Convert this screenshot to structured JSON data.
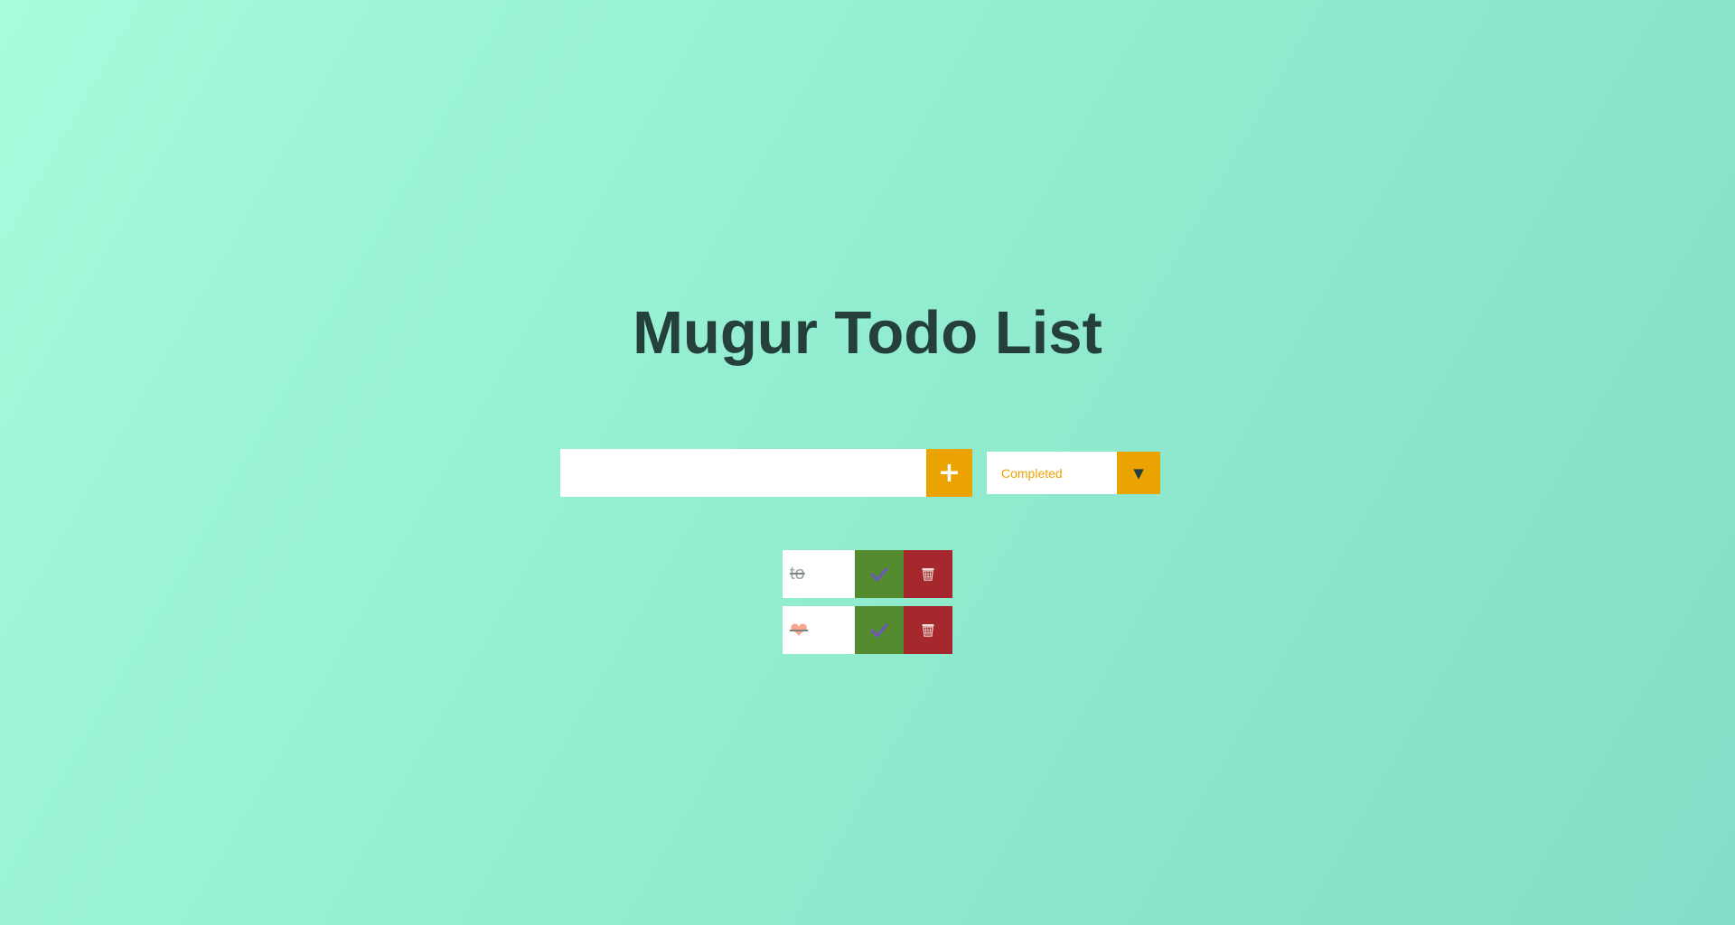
{
  "header": {
    "title": "Mugur Todo List"
  },
  "form": {
    "input_value": "",
    "input_placeholder": "",
    "add_icon": "plus-icon",
    "add_glyph": "+",
    "filter_selected": "Completed",
    "filter_arrow_glyph": "▼"
  },
  "todos": [
    {
      "text": "to",
      "completed": true
    },
    {
      "text": "❤",
      "completed": true
    }
  ],
  "colors": {
    "background_start": "#a6fcdb",
    "background_end": "#84dec7",
    "title": "#25403b",
    "accent": "#eaa300",
    "complete_button": "#558b2f",
    "trash_button": "#a4282c",
    "check_icon": "#6a5ab8"
  }
}
